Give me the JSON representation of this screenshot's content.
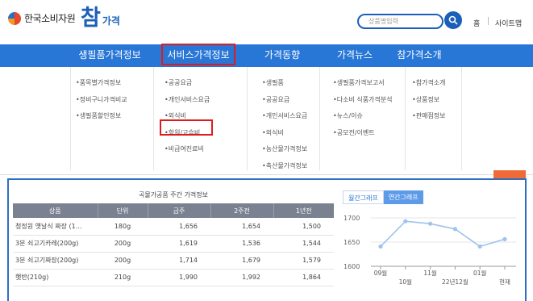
{
  "header": {
    "org_name": "한국소비자원",
    "brand_big": "참",
    "brand_small": "가격",
    "search_placeholder": "상품명입력",
    "links": [
      "홈",
      "사이트맵"
    ]
  },
  "gnb": {
    "items": [
      "생필품가격정보",
      "서비스가격정보",
      "가격동향",
      "가격뉴스",
      "참가격소개"
    ],
    "active_index": 1,
    "accent_color": "#2876d6",
    "highlight_color": "#e01b1b"
  },
  "dropdown": {
    "columns": [
      [
        "•품목별가격정보",
        "•정비구니가격비교",
        "•생필품할인정보"
      ],
      [
        "•공공요금",
        "•개인서비스요금",
        "•외식비",
        "•학원/교습비",
        "•비급여진료비"
      ],
      [
        "•생필품",
        "•공공요금",
        "•개인서비스요금",
        "•외식비",
        "•농산물가격정보",
        "•축산물가격정보"
      ],
      [
        "•생필품가격보고서",
        "•다소비 식품가격분석",
        "•뉴스/이슈",
        "•공모전/이벤트"
      ],
      [
        "•참가격소개",
        "•상품정보",
        "•판매점정보"
      ]
    ],
    "highlighted": "•학원/교습비"
  },
  "price_table": {
    "title": "곡물가공품 주간 가격정보",
    "headers": [
      "상품",
      "단위",
      "금주",
      "2주전",
      "1년전"
    ],
    "rows": [
      [
        "청정원 옛날식 짜장 (1...",
        "180g",
        "1,656",
        "1,654",
        "1,500"
      ],
      [
        "3분 쇠고기카레(200g)",
        "200g",
        "1,619",
        "1,536",
        "1,544"
      ],
      [
        "3분 쇠고기짜장(200g)",
        "200g",
        "1,714",
        "1,679",
        "1,579"
      ],
      [
        "햇반(210g)",
        "210g",
        "1,990",
        "1,992",
        "1,864"
      ]
    ]
  },
  "chart_tabs": [
    "월간그래프",
    "연간그래프"
  ],
  "chart_data": {
    "type": "line",
    "x": [
      "09월",
      "10월",
      "11월",
      "22년12월",
      "01월",
      "현재"
    ],
    "values": [
      1641,
      1693,
      1688,
      1677,
      1641,
      1656
    ],
    "ylim": [
      1600,
      1700
    ],
    "yticks": [
      1600,
      1650,
      1700
    ],
    "grid": true,
    "line_color": "#9ec3ec"
  }
}
